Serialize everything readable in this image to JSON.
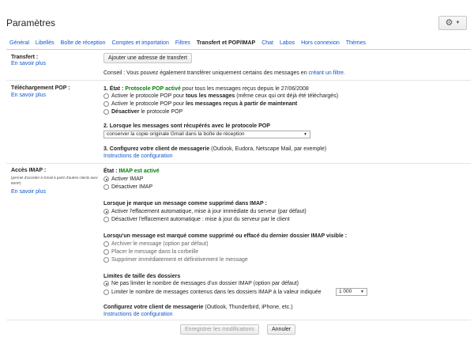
{
  "header": {
    "title": "Paramètres",
    "settings_icon": "gear-icon"
  },
  "tabs": [
    {
      "label": "Général",
      "active": false
    },
    {
      "label": "Libellés",
      "active": false
    },
    {
      "label": "Boîte de réception",
      "active": false
    },
    {
      "label": "Comptes et importation",
      "active": false
    },
    {
      "label": "Filtres",
      "active": false
    },
    {
      "label": "Transfert et POP/IMAP",
      "active": true
    },
    {
      "label": "Chat",
      "active": false
    },
    {
      "label": "Labos",
      "active": false
    },
    {
      "label": "Hors connexion",
      "active": false
    },
    {
      "label": "Thèmes",
      "active": false
    }
  ],
  "transfer": {
    "label": "Transfert :",
    "learn_more": "En savoir plus",
    "add_button": "Ajouter une adresse de transfert",
    "tip_prefix": "Conseil : Vous pouvez également transférer uniquement certains des messages en ",
    "tip_link": "créant un filtre."
  },
  "pop": {
    "label": "Téléchargement POP :",
    "learn_more": "En savoir plus",
    "status_prefix": "1. État : ",
    "status_value": "Protocole POP activé",
    "status_suffix": " pour tous les messages reçus depuis le 27/06/2008",
    "options": [
      {
        "pre": "Activer le protocole POP pour ",
        "bold": "tous les messages",
        "post": " (même ceux qui ont déjà été téléchargés)",
        "selected": false
      },
      {
        "pre": "Activer le protocole POP pour ",
        "bold": "les messages reçus à partir de maintenant",
        "post": "",
        "selected": false
      },
      {
        "pre": "",
        "bold": "Désactiver",
        "post": " le protocole POP",
        "selected": false
      }
    ],
    "step2": "2. Lorsque les messages sont récupérés avec le protocole POP",
    "step2_select": "conserver la copie originale Gmail dans la boîte de réception",
    "step3_bold": "3. Configurez votre client de messagerie",
    "step3_rest": " (Outlook, Eudora, Netscape Mail, par exemple)",
    "config_link": "Instructions de configuration"
  },
  "imap": {
    "label": "Accès IMAP :",
    "sub_label": "(permet d'accéder à Gmail à partir d'autres clients avec IMAP)",
    "learn_more": "En savoir plus",
    "status_prefix": "État : ",
    "status_value": "IMAP est activé",
    "enable_options": [
      {
        "label": "Activer IMAP",
        "selected": true
      },
      {
        "label": "Désactiver IMAP",
        "selected": false
      }
    ],
    "delete_heading": "Lorsque je marque un message comme supprimé dans IMAP :",
    "delete_options": [
      {
        "label": "Activer l'effacement automatique, mise à jour immédiate du serveur (par défaut)",
        "selected": true
      },
      {
        "label": "Désactiver l'effacement automatique : mise à jour du serveur par le client",
        "selected": false
      }
    ],
    "expunge_heading": "Lorsqu'un message est marqué comme supprimé ou effacé du dernier dossier IMAP visible :",
    "expunge_options": [
      {
        "label": "Archiver le message (option par défaut)",
        "selected": false
      },
      {
        "label": "Placer le message dans la corbeille",
        "selected": false
      },
      {
        "label": "Supprimer immédiatement et définitivement le message",
        "selected": false
      }
    ],
    "folder_heading": "Limites de taille des dossiers",
    "folder_options": [
      {
        "label": "Ne pas limiter le nombre de messages d'un dossier IMAP (option par défaut)",
        "selected": true
      },
      {
        "label": "Limiter le nombre de messages contenus dans les dossiers IMAP à la valeur indiquée",
        "selected": false
      }
    ],
    "folder_limit": "1 000",
    "config_bold": "Configurez votre client de messagerie",
    "config_rest": " (Outlook, Thunderbird, iPhone, etc.)",
    "config_link": "Instructions de configuration"
  },
  "footer": {
    "save": "Enregistrer les modifications",
    "cancel": "Annuler"
  }
}
